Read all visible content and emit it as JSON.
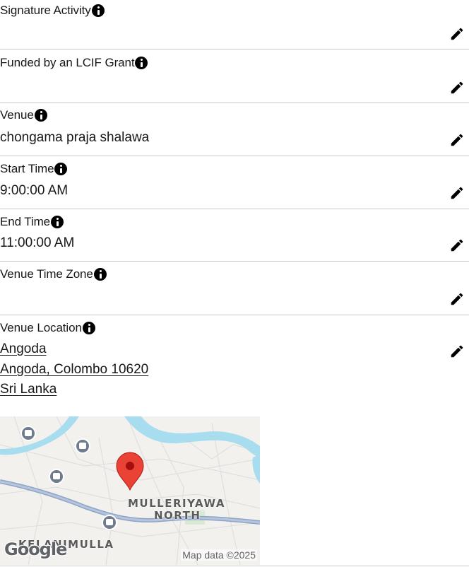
{
  "fields": [
    {
      "label": "Signature Activity",
      "value": ""
    },
    {
      "label": "Funded by an LCIF Grant",
      "value": ""
    },
    {
      "label": "Venue",
      "value": "chongama praja shalawa"
    },
    {
      "label": "Start Time",
      "value": "9:00:00 AM"
    },
    {
      "label": "End Time",
      "value": "11:00:00 AM"
    },
    {
      "label": "Venue Time Zone",
      "value": ""
    }
  ],
  "venue_location": {
    "label": "Venue Location",
    "street": "Angoda",
    "city_line": "Angoda, Colombo 10620",
    "country": "Sri Lanka"
  },
  "map": {
    "area_1": "MULLERIYAWA",
    "area_2": "NORTH",
    "area_3": "KELANIMULLA",
    "logo": "Google",
    "attribution": "Map data ©2025",
    "pin_color": "#ea4335",
    "river_color": "#a8dcef",
    "road_color": "#8fa4c7"
  },
  "icons": {
    "info": "info-icon",
    "edit": "pencil-icon",
    "pin": "map-pin-icon",
    "bus": "bus-stop-icon"
  }
}
